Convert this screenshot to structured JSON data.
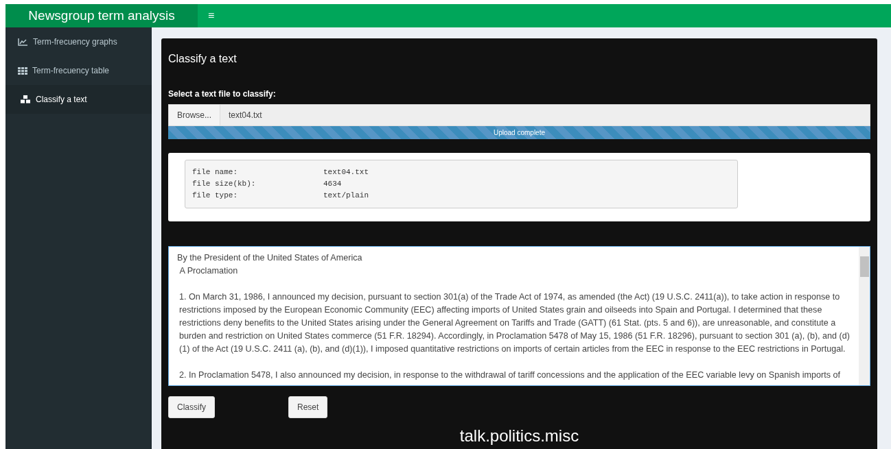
{
  "header": {
    "title": "Newsgroup term analysis",
    "menu_icon": "≡"
  },
  "sidebar": {
    "items": [
      {
        "label": "Term-frecuency graphs",
        "selected": false
      },
      {
        "label": "Term-frecuency table",
        "selected": false
      },
      {
        "label": "Classify a text",
        "selected": true
      }
    ]
  },
  "panel": {
    "title": "Classify a text",
    "file_input": {
      "label": "Select a text file to classify:",
      "button": "Browse...",
      "value": "text04.txt"
    },
    "progress": {
      "level": 1,
      "text": "Upload complete"
    },
    "file_info": [
      {
        "key": "file name:",
        "value": "text04.txt"
      },
      {
        "key": "file size(kb):",
        "value": "4634"
      },
      {
        "key": "file type:",
        "value": "text/plain"
      }
    ],
    "text_area": {
      "paragraphs": [
        "By the President of the United States of America\n A Proclamation",
        "1. On March 31, 1986, I announced my decision, pursuant to section 301(a) of the Trade Act of 1974, as amended (the Act) (19 U.S.C. 2411(a)), to take action in response to restrictions imposed by the European Economic Community (EEC) affecting imports of United States grain and oilseeds into Spain and Portugal. I determined that these restrictions deny benefits to the United States arising under the General Agreement on Tariffs and Trade (GATT) (61 Stat. (pts. 5 and 6)), are unreasonable, and constitute a burden and restriction on United States commerce (51 F.R. 18294). Accordingly, in Proclamation 5478 of May 15, 1986 (51 F.R. 18296), pursuant to section 301 (a), (b), and (d) (1) of the Act (19 U.S.C. 2411 (a), (b), and (d)(1)), I imposed quantitative restrictions on imports of certain articles from the EEC in response to the EEC restrictions in Portugal.",
        "2. In Proclamation 5478, I also announced my decision, in response to the withdrawal of tariff concessions and the application of the EEC variable levy on Spanish imports of"
      ]
    },
    "buttons": [
      "Classify",
      "Reset"
    ],
    "result": "talk.politics.misc"
  }
}
